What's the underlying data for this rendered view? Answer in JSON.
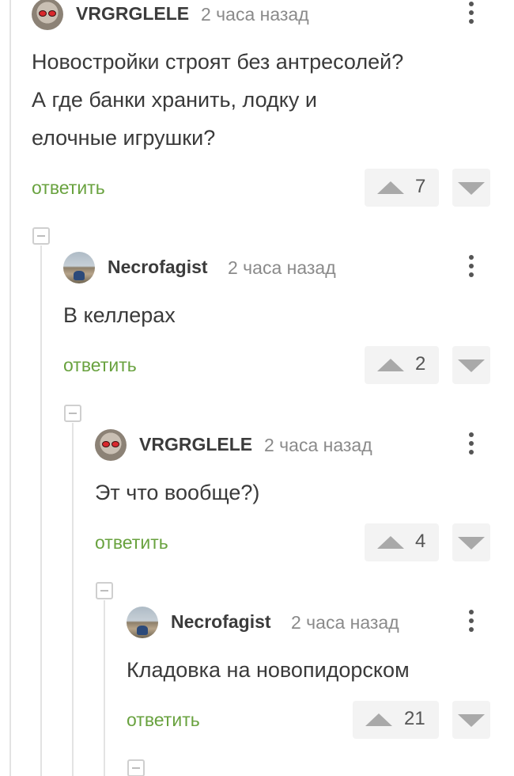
{
  "comments": [
    {
      "username": "VRGRGLELE",
      "time": "2 часа назад",
      "text_lines": [
        "Новостройки строят без антресолей?",
        "А где банки хранить, лодку и",
        "елочные игрушки?"
      ],
      "reply_label": "ответить",
      "votes": "7",
      "avatar": "sunglasses-avatar"
    },
    {
      "username": "Necrofagist",
      "time": "2 часа назад",
      "text_lines": [
        "В келлерах"
      ],
      "reply_label": "ответить",
      "votes": "2",
      "avatar": "landscape-avatar"
    },
    {
      "username": "VRGRGLELE",
      "time": "2 часа назад",
      "text_lines": [
        "Эт что вообще?)"
      ],
      "reply_label": "ответить",
      "votes": "4",
      "avatar": "sunglasses-avatar"
    },
    {
      "username": "Necrofagist",
      "time": "2 часа назад",
      "text_lines": [
        "Кладовка на новопидорском"
      ],
      "reply_label": "ответить",
      "votes": "21",
      "avatar": "landscape-avatar"
    }
  ],
  "icons": {
    "upvote": "triangle-up-icon",
    "downvote": "triangle-down-icon",
    "more": "vertical-dots-icon",
    "collapse": "minus-box-icon"
  },
  "colors": {
    "reply": "#69a23f",
    "username": "#3b3b3b",
    "timestamp": "#8a8a8a",
    "vote_bg": "#f3f3f3"
  }
}
